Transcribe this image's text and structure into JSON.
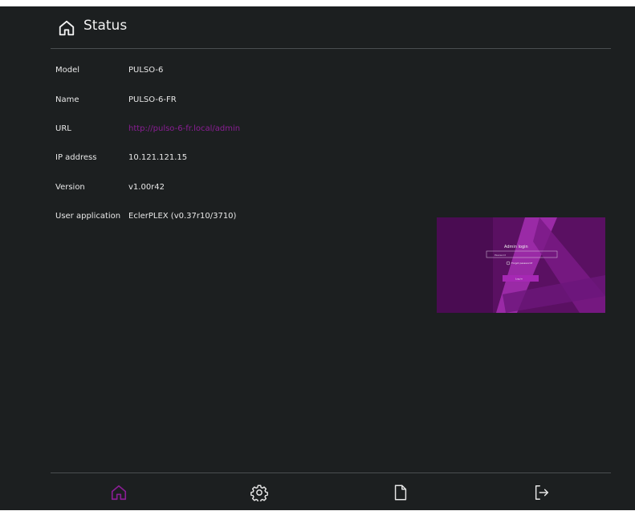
{
  "header": {
    "title": "Status",
    "icon": "home-icon"
  },
  "status_rows": [
    {
      "label": "Model",
      "value": "PULSO-6"
    },
    {
      "label": "Name",
      "value": "PULSO-6-FR"
    },
    {
      "label": "URL",
      "value": "http://pulso-6-fr.local/admin"
    },
    {
      "label": "IP address",
      "value": "10.121.121.15"
    },
    {
      "label": "Version",
      "value": "v1.00r42"
    },
    {
      "label": "User application",
      "value": "EclerPLEX (v0.37r10/3710)"
    }
  ],
  "preview": {
    "title": "Admin login",
    "password_placeholder": "Password",
    "forgot_label": "Forgot password?",
    "login_label": "Log in"
  },
  "footer_nav": [
    {
      "icon": "home-icon",
      "active": true
    },
    {
      "icon": "gear-icon",
      "active": false
    },
    {
      "icon": "document-icon",
      "active": false
    },
    {
      "icon": "logout-icon",
      "active": false
    }
  ],
  "colors": {
    "background": "#1c1f20",
    "accent": "#8a1e94",
    "text": "#e8e8e8",
    "divider": "#4a4e50"
  }
}
